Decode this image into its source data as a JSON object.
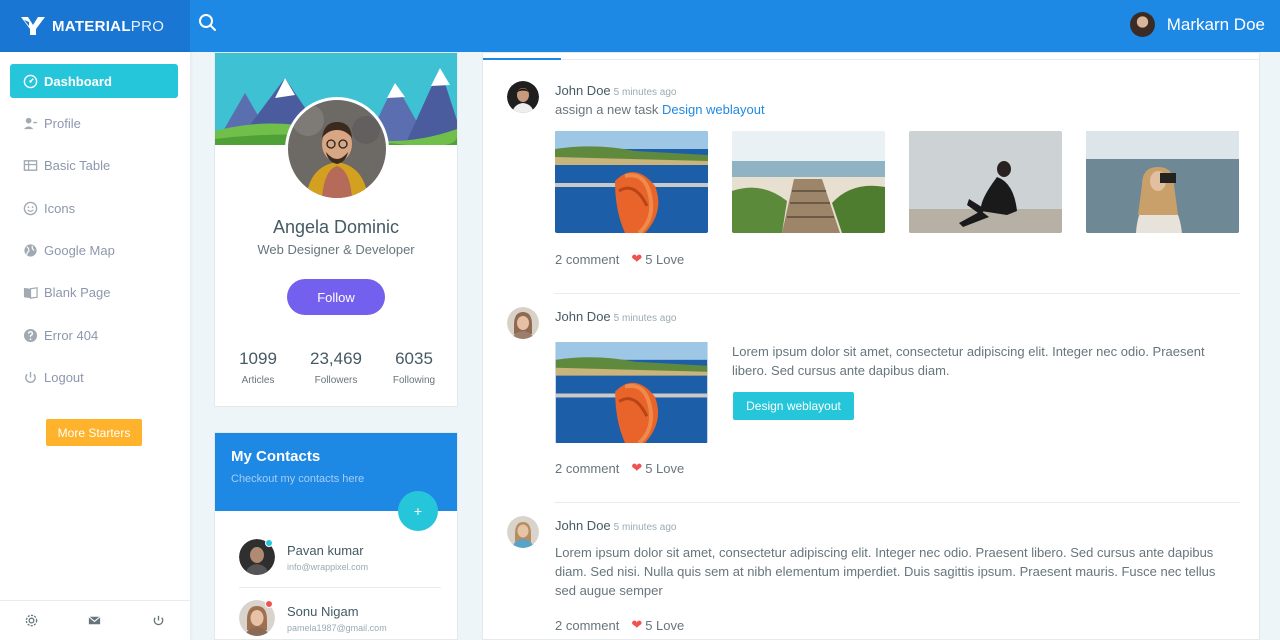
{
  "brand": {
    "bold": "MATERIAL",
    "light": "PRO"
  },
  "topbar": {
    "username": "Markarn Doe"
  },
  "sidebar": {
    "items": [
      {
        "label": "Dashboard",
        "icon": "gauge-icon"
      },
      {
        "label": "Profile",
        "icon": "user-icon"
      },
      {
        "label": "Basic Table",
        "icon": "table-icon"
      },
      {
        "label": "Icons",
        "icon": "smiley-icon"
      },
      {
        "label": "Google Map",
        "icon": "globe-icon"
      },
      {
        "label": "Blank Page",
        "icon": "book-icon"
      },
      {
        "label": "Error 404",
        "icon": "help-icon"
      },
      {
        "label": "Logout",
        "icon": "power-icon"
      }
    ],
    "more_label": "More Starters"
  },
  "profile": {
    "name": "Angela Dominic",
    "role": "Web Designer & Developer",
    "follow_label": "Follow",
    "stats": [
      {
        "value": "1099",
        "label": "Articles"
      },
      {
        "value": "23,469",
        "label": "Followers"
      },
      {
        "value": "6035",
        "label": "Following"
      }
    ]
  },
  "contacts": {
    "title": "My Contacts",
    "subtitle": "Checkout my contacts here",
    "add_label": "+",
    "items": [
      {
        "name": "Pavan kumar",
        "email": "info@wrappixel.com",
        "status_color": "#26c6da"
      },
      {
        "name": "Sonu Nigam",
        "email": "pamela1987@gmail.com",
        "status_color": "#ef5350"
      }
    ]
  },
  "feed": {
    "posts": [
      {
        "author": "John Doe",
        "time": "5 minutes ago",
        "text": "assign a new task",
        "link": "Design weblayout",
        "comments": "2 comment",
        "love": "5 Love"
      },
      {
        "author": "John Doe",
        "time": "5 minutes ago",
        "text": "Lorem ipsum dolor sit amet, consectetur adipiscing elit. Integer nec odio. Praesent libero. Sed cursus ante dapibus diam.",
        "button": "Design weblayout",
        "comments": "2 comment",
        "love": "5 Love"
      },
      {
        "author": "John Doe",
        "time": "5 minutes ago",
        "text": "Lorem ipsum dolor sit amet, consectetur adipiscing elit. Integer nec odio. Praesent libero. Sed cursus ante dapibus diam. Sed nisi. Nulla quis sem at nibh elementum imperdiet. Duis sagittis ipsum. Praesent mauris. Fusce nec tellus sed augue semper",
        "comments": "2 comment",
        "love": "5 Love"
      }
    ]
  },
  "colors": {
    "topbar": "#1e88e5",
    "brand_bg": "#1976d2",
    "active": "#26c6da",
    "follow": "#7460ee",
    "warning": "#ffb22b",
    "heart": "#ef5350"
  }
}
